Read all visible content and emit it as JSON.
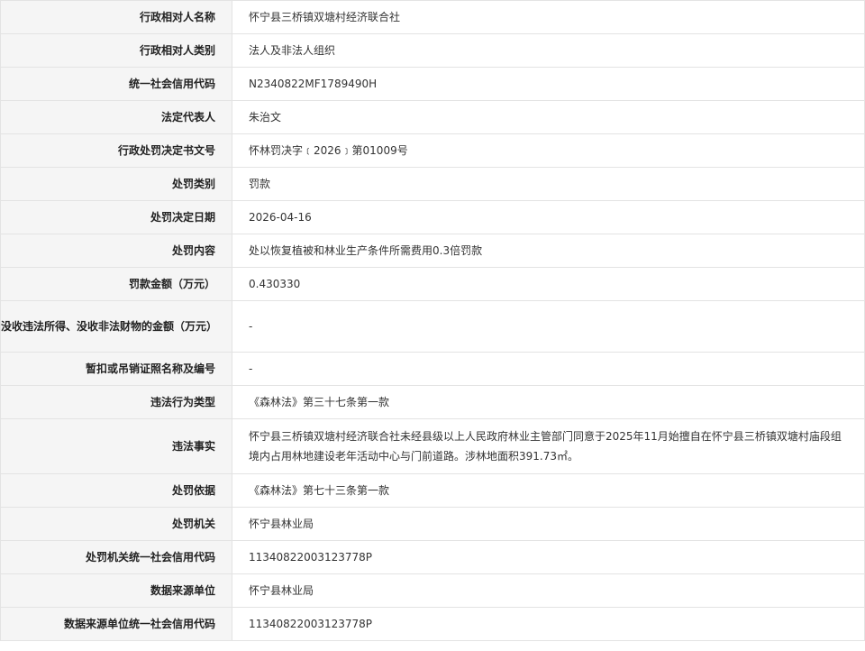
{
  "rows": [
    {
      "label": "行政相对人名称",
      "value": "怀宁县三桥镇双塘村经济联合社"
    },
    {
      "label": "行政相对人类别",
      "value": "法人及非法人组织"
    },
    {
      "label": "统一社会信用代码",
      "value": "N2340822MF1789490H"
    },
    {
      "label": "法定代表人",
      "value": "朱治文"
    },
    {
      "label": "行政处罚决定书文号",
      "value": "怀林罚决字﹝2026﹞第01009号"
    },
    {
      "label": "处罚类别",
      "value": "罚款"
    },
    {
      "label": "处罚决定日期",
      "value": "2026-04-16"
    },
    {
      "label": "处罚内容",
      "value": "处以恢复植被和林业生产条件所需费用0.3倍罚款"
    },
    {
      "label": "罚款金额（万元）",
      "value": "0.430330"
    },
    {
      "label": "没收违法所得、没收非法财物的金额（万元）",
      "value": "-"
    },
    {
      "label": "暂扣或吊销证照名称及编号",
      "value": "-"
    },
    {
      "label": "违法行为类型",
      "value": "《森林法》第三十七条第一款"
    },
    {
      "label": "违法事实",
      "value": "怀宁县三桥镇双塘村经济联合社未经县级以上人民政府林业主管部门同意于2025年11月始擅自在怀宁县三桥镇双塘村庙段组境内占用林地建设老年活动中心与门前道路。涉林地面积391.73㎡。"
    },
    {
      "label": "处罚依据",
      "value": "《森林法》第七十三条第一款"
    },
    {
      "label": "处罚机关",
      "value": "怀宁县林业局"
    },
    {
      "label": "处罚机关统一社会信用代码",
      "value": "11340822003123778P"
    },
    {
      "label": "数据来源单位",
      "value": "怀宁县林业局"
    },
    {
      "label": "数据来源单位统一社会信用代码",
      "value": "11340822003123778P"
    }
  ]
}
